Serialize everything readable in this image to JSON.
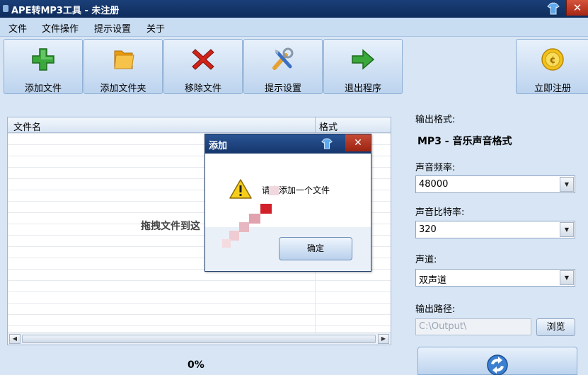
{
  "window": {
    "title": "APE转MP3工具 - 未注册"
  },
  "menu": [
    "文件",
    "文件操作",
    "提示设置",
    "关于"
  ],
  "toolbar": {
    "add_file": "添加文件",
    "add_folder": "添加文件夹",
    "remove_file": "移除文件",
    "prompt_settings": "提示设置",
    "exit": "退出程序",
    "register": "立即注册"
  },
  "file_list": {
    "col_name": "文件名",
    "col_format": "格式",
    "drop_hint": "拖拽文件到这"
  },
  "progress": {
    "value": 0,
    "text": "0%"
  },
  "settings": {
    "output_format_label": "输出格式:",
    "output_format_value": "MP3 - 音乐声音格式",
    "sample_rate_label": "声音频率:",
    "sample_rate_value": "48000",
    "bitrate_label": "声音比特率:",
    "bitrate_value": "320",
    "channel_label": "声道:",
    "channel_value": "双声道",
    "output_path_label": "输出路径:",
    "output_path_placeholder": "C:\\Output\\",
    "browse_label": "浏览"
  },
  "dialog": {
    "title": "添加",
    "message": "请先添加一个文件",
    "ok_label": "确定"
  },
  "colors": {
    "titlebar": "#15366d",
    "accent_green": "#3aa83a",
    "accent_red": "#d0231a",
    "accent_orange": "#f2a61b"
  }
}
